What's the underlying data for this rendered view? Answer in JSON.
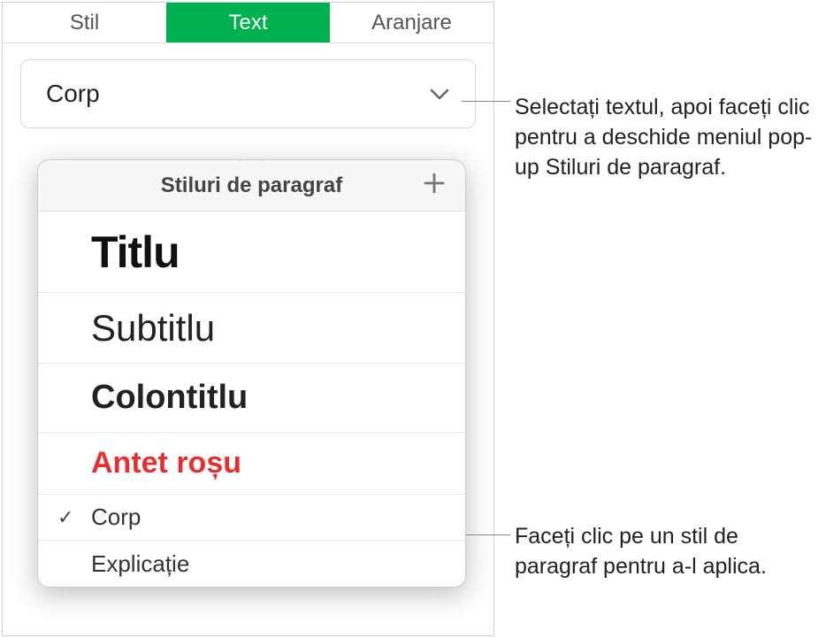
{
  "tabs": {
    "stil": "Stil",
    "text": "Text",
    "aranjare": "Aranjare"
  },
  "dropdown": {
    "value": "Corp"
  },
  "popover": {
    "title": "Stiluri de paragraf",
    "items": {
      "titlu": "Titlu",
      "subtitlu": "Subtitlu",
      "colontitlu": "Colontitlu",
      "antet_rosu": "Antet roșu",
      "corp": "Corp",
      "explicatie": "Explicație"
    },
    "selected": "corp"
  },
  "callouts": {
    "top": "Selectați textul, apoi faceți clic pentru a deschide meniul pop-up Stiluri de paragraf.",
    "bottom": "Faceți clic pe un stil de paragraf pentru a-l aplica."
  }
}
